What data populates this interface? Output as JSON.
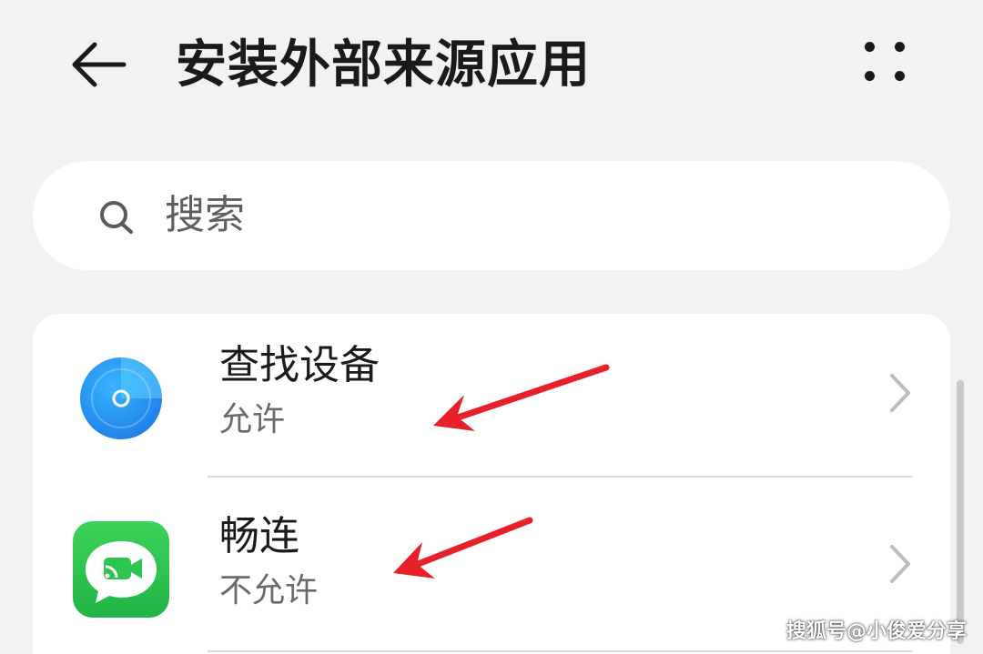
{
  "header": {
    "back_icon": "back-arrow-icon",
    "title": "安装外部来源应用",
    "more_icon": "more-dots-icon"
  },
  "search": {
    "icon": "search-icon",
    "placeholder": "搜索"
  },
  "apps": [
    {
      "name": "查找设备",
      "status": "允许",
      "icon": "find-device-icon",
      "icon_color": "#2d9bf0"
    },
    {
      "name": "畅连",
      "status": "不允许",
      "icon": "meetime-icon",
      "icon_color": "#2ec452"
    }
  ],
  "colors": {
    "background": "#f1f2f4",
    "card": "#ffffff",
    "annotation_arrow": "#e8202a"
  },
  "watermark": "搜狐号@小俊爱分享"
}
